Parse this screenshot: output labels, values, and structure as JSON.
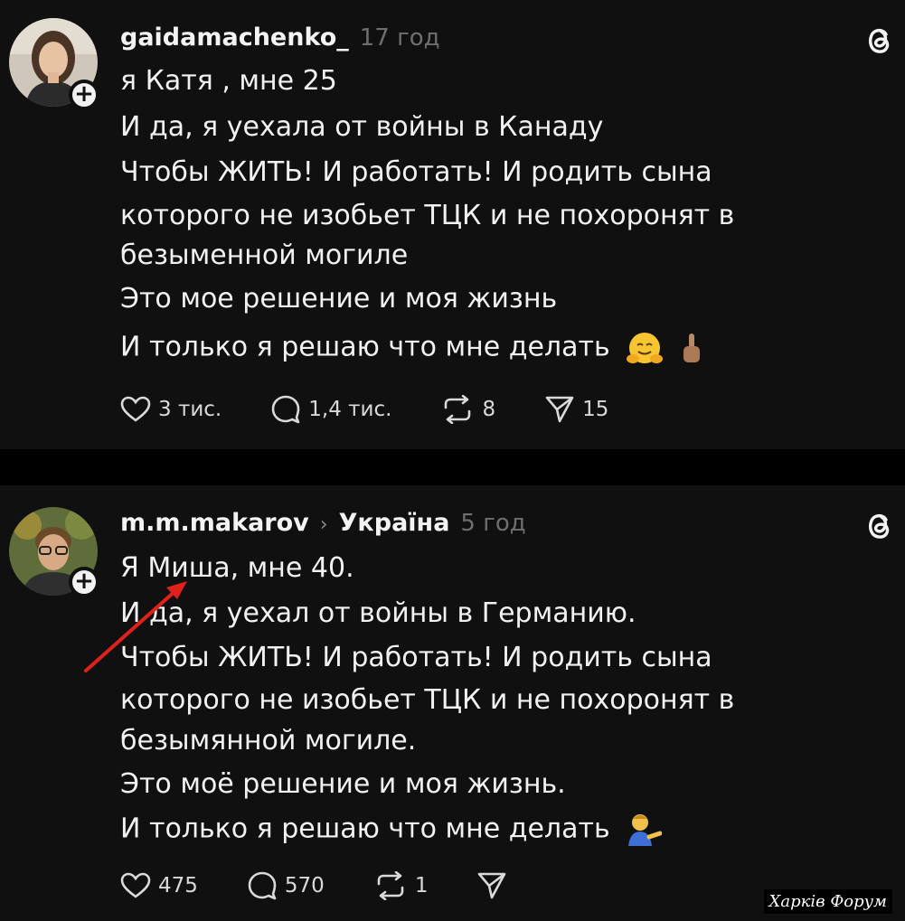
{
  "posts": [
    {
      "username": "gaidamachenko_",
      "time": "17 год",
      "lines": [
        "я Катя , мне 25",
        "И да, я уехала от войны в Канаду",
        "Чтобы ЖИТЬ! И работать! И родить сына",
        "которого не изобьет ТЦК и не похоронят в",
        "безыменной могиле",
        "Это мое решение и моя жизнь",
        "И только я решаю что мне делать"
      ],
      "stats": {
        "likes": "3 тис.",
        "comments": "1,4 тис.",
        "reposts": "8",
        "shares": "15"
      }
    },
    {
      "username": "m.m.makarov",
      "region": "Україна",
      "time": "5 год",
      "lines": [
        "Я Миша, мне 40.",
        "И да, я уехал от войны в Германию.",
        "Чтобы ЖИТЬ! И работать! И родить сына",
        "которого не изобьет ТЦК и не похоронят в",
        "безымянной могиле.",
        "Это моё решение и моя жизнь.",
        "И только я решаю что мне делать"
      ],
      "stats": {
        "likes": "475",
        "comments": "570",
        "reposts": "1"
      }
    }
  ],
  "watermark": "Харків Форум",
  "icons": [
    "plus-icon",
    "threads-icon",
    "heart-icon",
    "comment-icon",
    "repost-icon",
    "share-icon",
    "chevron-right-icon",
    "hugging-face-emoji",
    "middle-finger-emoji",
    "shrugging-man-emoji"
  ],
  "colors": {
    "background": "#101010",
    "separator": "#000000",
    "text": "#f1f1f1",
    "muted": "#6e6e6e",
    "arrow": "#e0211b"
  }
}
